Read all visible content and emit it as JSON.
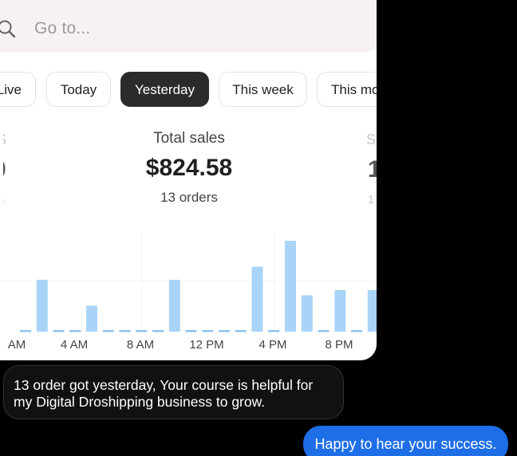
{
  "search": {
    "placeholder": "Go to..."
  },
  "tabs": [
    {
      "label": "Live",
      "selected": false
    },
    {
      "label": "Today",
      "selected": false
    },
    {
      "label": "Yesterday",
      "selected": true
    },
    {
      "label": "This week",
      "selected": false
    },
    {
      "label": "This month",
      "selected": false
    }
  ],
  "summary": {
    "label": "Total sales",
    "value": "$824.58",
    "orders": "13 orders"
  },
  "chart_data": {
    "type": "bar",
    "categories": [
      0,
      1,
      2,
      3,
      4,
      5,
      6,
      7,
      8,
      9,
      10,
      11,
      12,
      13,
      14,
      15,
      16,
      17,
      18,
      19,
      20,
      21,
      22,
      23
    ],
    "values": [
      0,
      2,
      0,
      0,
      1,
      0,
      0,
      0,
      0,
      2,
      0,
      0,
      0,
      0,
      2.5,
      0,
      3.5,
      1.4,
      0,
      1.6,
      0,
      1.6,
      1.2,
      0
    ],
    "x_tick_labels": [
      "AM",
      "4 AM",
      "8 AM",
      "12 PM",
      "4 PM",
      "8 PM"
    ],
    "bar_color": "#a9d4f7",
    "baseline_color": "#8cc4f2"
  },
  "messages": {
    "incoming": "13 order got yesterday, Your course is helpful for my Digital Droshipping business to grow.",
    "outgoing": "Happy to hear your success."
  }
}
